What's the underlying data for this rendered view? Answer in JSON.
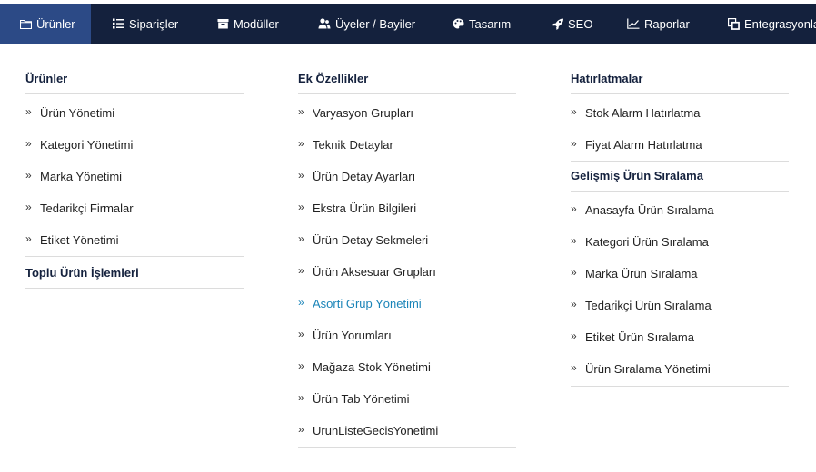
{
  "nav": {
    "items": [
      {
        "label": "Ürünler",
        "icon": "folder-icon",
        "active": true
      },
      {
        "label": "Siparişler",
        "icon": "list-icon"
      },
      {
        "label": "Modüller",
        "icon": "box-icon"
      },
      {
        "label": "Üyeler / Bayiler",
        "icon": "users-icon"
      },
      {
        "label": "Tasarım",
        "icon": "palette-icon"
      },
      {
        "label": "SEO",
        "icon": "rocket-icon"
      },
      {
        "label": "Raporlar",
        "icon": "chart-icon"
      },
      {
        "label": "Entegrasyonlar",
        "icon": "copy-icon"
      }
    ]
  },
  "menu": {
    "col1": {
      "title": "Ürünler",
      "items": [
        "Ürün Yönetimi",
        "Kategori Yönetimi",
        "Marka Yönetimi",
        "Tedarikçi Firmalar",
        "Etiket Yönetimi"
      ],
      "title2": "Toplu Ürün İşlemleri"
    },
    "col2": {
      "title": "Ek Özellikler",
      "items": [
        "Varyasyon Grupları",
        "Teknik Detaylar",
        "Ürün Detay Ayarları",
        "Ekstra Ürün Bilgileri",
        "Ürün Detay Sekmeleri",
        "Ürün Aksesuar Grupları",
        "Asorti Grup Yönetimi",
        "Ürün Yorumları",
        "Mağaza Stok Yönetimi",
        "Ürün Tab Yönetimi",
        "UrunListeGecisYonetimi"
      ],
      "highlighted_index": 6
    },
    "col3": {
      "title": "Hatırlatmalar",
      "items": [
        "Stok Alarm Hatırlatma",
        "Fiyat Alarm Hatırlatma"
      ],
      "title2": "Gelişmiş Ürün Sıralama",
      "items2": [
        "Anasayfa Ürün Sıralama",
        "Kategori Ürün Sıralama",
        "Marka Ürün Sıralama",
        "Tedarikçi Ürün Sıralama",
        "Etiket Ürün Sıralama",
        "Ürün Sıralama Yönetimi"
      ]
    }
  },
  "colors": {
    "nav_bg": "#14213d",
    "nav_active_bg": "#2c4a86",
    "highlight": "#1a84b8"
  }
}
